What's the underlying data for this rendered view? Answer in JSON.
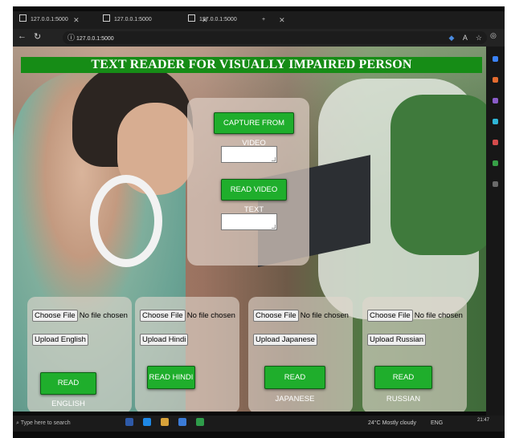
{
  "browser": {
    "tabs": [
      {
        "label": "127.0.0.1:5000"
      },
      {
        "label": "127.0.0.1:5000"
      },
      {
        "label": "127.0.0.1:5000"
      }
    ],
    "url": "127.0.0.1:5000"
  },
  "page": {
    "title": "TEXT READER FOR VISUALLY IMPAIRED PERSON",
    "capture_label": "CAPTURE FROM VIDEO",
    "read_video_label": "READ VIDEO TEXT",
    "cards": [
      {
        "choose_label": "Choose File",
        "no_file": "No file chosen",
        "upload_label": "Upload English",
        "read_label": "READ ENGLISH"
      },
      {
        "choose_label": "Choose File",
        "no_file": "No file chosen",
        "upload_label": "Upload Hindi",
        "read_label": "READ HINDI"
      },
      {
        "choose_label": "Choose File",
        "no_file": "No file chosen",
        "upload_label": "Upload Japanese",
        "read_label": "READ JAPANESE"
      },
      {
        "choose_label": "Choose File",
        "no_file": "No file chosen",
        "upload_label": "Upload Russian",
        "read_label": "READ RUSSIAN"
      }
    ]
  },
  "taskbar": {
    "search_placeholder": "Type here to search",
    "weather": "24°C Mostly cloudy",
    "lang": "ENG",
    "clock": "21:47"
  },
  "colors": {
    "accent_green": "#1fae2c",
    "title_green": "#168c16"
  }
}
